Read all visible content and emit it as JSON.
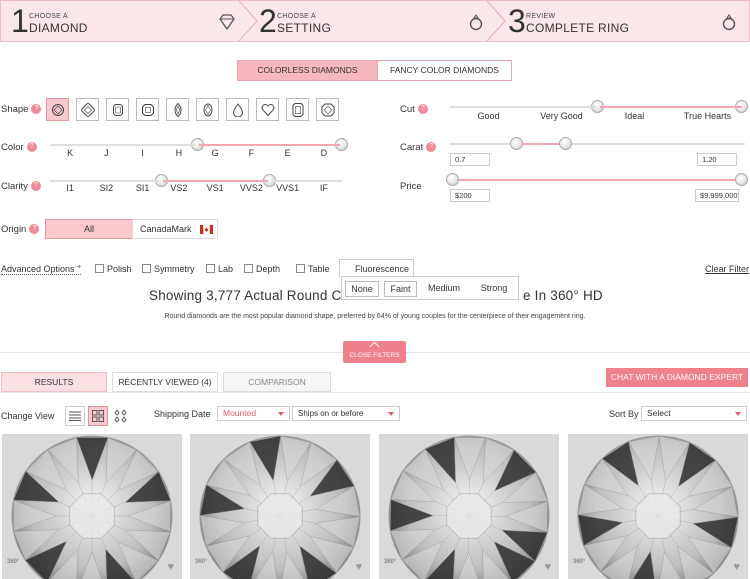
{
  "steps": [
    {
      "num": "1",
      "small": "CHOOSE A",
      "big": "DIAMOND",
      "icon": "diamond-icon"
    },
    {
      "num": "2",
      "small": "CHOOSE A",
      "big": "SETTING",
      "icon": "ring-icon"
    },
    {
      "num": "3",
      "small": "REVIEW",
      "big": "COMPLETE RING",
      "icon": "ring-icon"
    }
  ],
  "color_toggle": {
    "colorless": "COLORLESS DIAMONDS",
    "fancy": "FANCY COLOR DIAMONDS",
    "selected": "colorless"
  },
  "filters": {
    "shape_label": "Shape",
    "color_label": "Color",
    "clarity_label": "Clarity",
    "origin_label": "Origin",
    "cut_label": "Cut",
    "carat_label": "Carat",
    "price_label": "Price",
    "help": "?",
    "colors": [
      "K",
      "J",
      "I",
      "H",
      "G",
      "F",
      "E",
      "D"
    ],
    "color_range": [
      "G",
      "D"
    ],
    "clarities": [
      "I1",
      "SI2",
      "SI1",
      "VS2",
      "VS1",
      "VVS2",
      "VVS1",
      "IF"
    ],
    "clarity_range": [
      "VS2",
      "VVS2"
    ],
    "cuts": [
      "Good",
      "Very Good",
      "Ideal",
      "True Hearts"
    ],
    "cut_range": [
      "Ideal",
      "True Hearts"
    ],
    "carat_min": "0.7",
    "carat_max": "1.20",
    "price_min": "$200",
    "price_max": "$9,999,000",
    "origin_all": "All",
    "origin_canada": "CanadaMark"
  },
  "advanced": {
    "label": "Advanced Options",
    "marker": "+",
    "options": [
      "Polish",
      "Symmetry",
      "Lab",
      "Depth",
      "Table",
      "Fluorescence"
    ],
    "checked": "Fluorescence",
    "clear": "Clear Filter",
    "fluorescence": [
      "None",
      "Faint",
      "Medium",
      "Strong"
    ]
  },
  "headline_left": "Showing 3,777 Actual Round C",
  "headline_right": "e In 360° HD",
  "subheadline": "Round diamonds are the most popular diamond shape, preferred by 64% of young couples for the centerpiece of their engagement ring.",
  "close_filters": "CLOSE FILTERS",
  "tabs": [
    "RESULTS",
    "RECENTLY VIEWED (4)",
    "COMPARISON"
  ],
  "chat": "CHAT WITH A DIAMOND EXPERT",
  "toolbar": {
    "change_view": "Change View",
    "shipping_date": "Shipping Date",
    "shipping_value": "Mounted",
    "ships_on": "Ships on or before",
    "sort_by": "Sort By",
    "sort_value": "Select"
  },
  "badge_360": "360°",
  "colors": {
    "accent": "#f08089",
    "selected_bg": "#f8c8cd",
    "header_bg": "#fbe7e9"
  }
}
